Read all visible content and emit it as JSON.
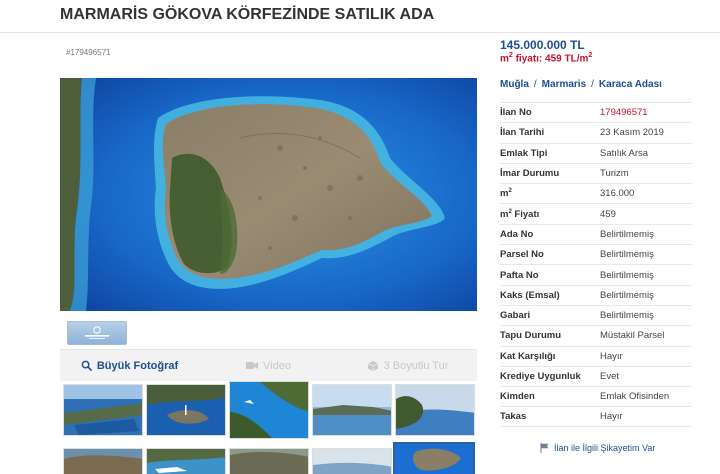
{
  "page": {
    "title": "MARMARİS GÖKOVA KÖRFEZİNDE SATILIK ADA",
    "listing_id_small": "#179496571"
  },
  "pricing": {
    "price": "145.000.000 TL",
    "unit_price_prefix": "m",
    "unit_price_sup": "2",
    "unit_price_middle": " fiyatı: 459 TL/m",
    "unit_price_sup2": "2"
  },
  "breadcrumb": {
    "city": "Muğla",
    "district": "Marmaris",
    "neighborhood": "Karaca Adası",
    "separator": "/"
  },
  "media_tabs": {
    "photo": "Büyük Fotoğraf",
    "video": "Video",
    "tour": "3 Boyutlu Tur"
  },
  "details": [
    {
      "label": "İlan No",
      "value": "179496571"
    },
    {
      "label": "İlan Tarihi",
      "value": "23 Kasım 2019"
    },
    {
      "label": "Emlak Tipi",
      "value": "Satılık Arsa"
    },
    {
      "label": "İmar Durumu",
      "value": "Turizm"
    },
    {
      "label": "m",
      "label_sup": "2",
      "value": "316.000"
    },
    {
      "label": "m",
      "label_sup": "2",
      "label_suffix": " Fiyatı",
      "value": "459"
    },
    {
      "label": "Ada No",
      "value": "Belirtilmemiş"
    },
    {
      "label": "Parsel No",
      "value": "Belirtilmemiş"
    },
    {
      "label": "Pafta No",
      "value": "Belirtilmemiş"
    },
    {
      "label": "Kaks (Emsal)",
      "value": "Belirtilmemiş"
    },
    {
      "label": "Gabari",
      "value": "Belirtilmemiş"
    },
    {
      "label": "Tapu Durumu",
      "value": "Müstakil Parsel"
    },
    {
      "label": "Kat Karşılığı",
      "value": "Hayır"
    },
    {
      "label": "Krediye Uygunluk",
      "value": "Evet"
    },
    {
      "label": "Kimden",
      "value": "Emlak Ofisinden"
    },
    {
      "label": "Takas",
      "value": "Hayır"
    }
  ],
  "complaint_link": "İlan ile İlgili Şikayetim Var",
  "colors": {
    "accent_blue": "#1c4f92",
    "accent_red": "#c8102e",
    "sea": "#1a6fd0"
  },
  "icons": {
    "photo_tab": "magnifier-icon",
    "video_tab": "video-camera-icon",
    "tour_tab": "cube-icon",
    "complaint": "flag-icon"
  }
}
